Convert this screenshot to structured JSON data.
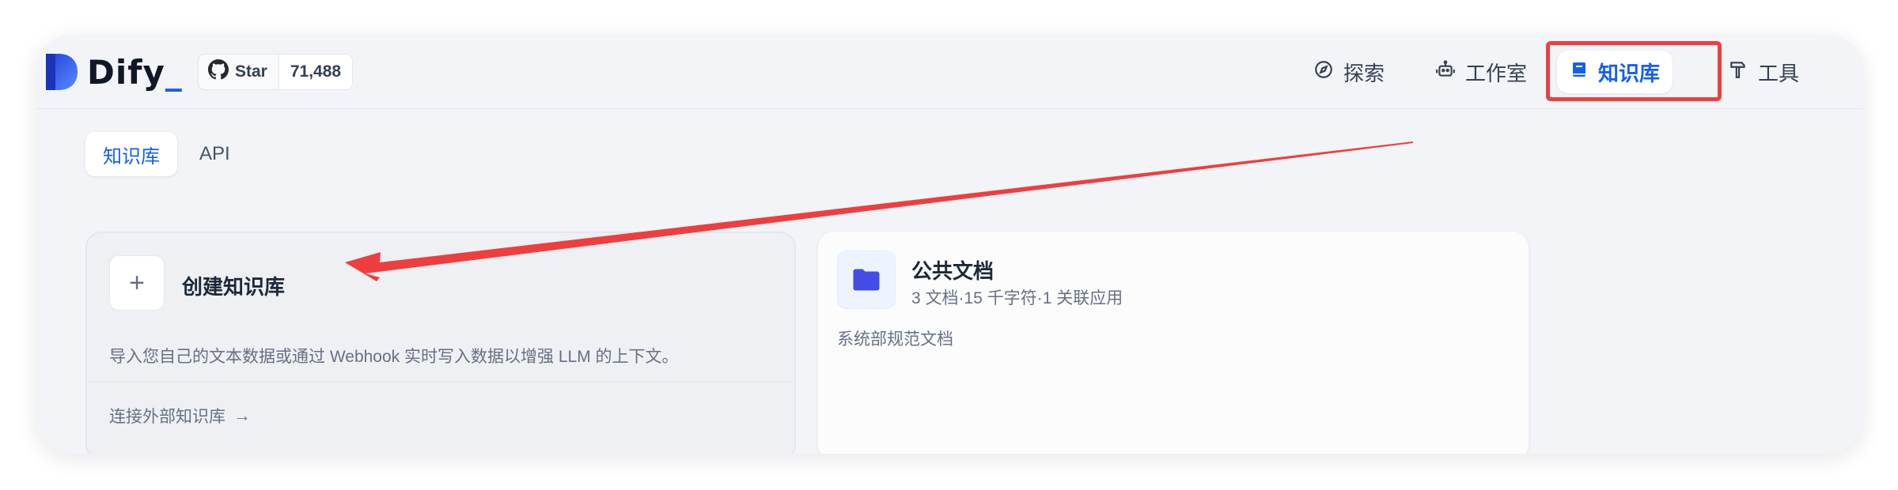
{
  "brand": {
    "name": "Dify",
    "underscore": "_",
    "accent": "#155eef"
  },
  "github": {
    "star_label": "Star",
    "star_count": "71,488",
    "icon": "github-icon"
  },
  "nav": {
    "items": [
      {
        "label": "探索",
        "icon": "compass-icon"
      },
      {
        "label": "工作室",
        "icon": "robot-icon"
      },
      {
        "label": "知识库",
        "icon": "book-icon",
        "active": true
      },
      {
        "label": "工具",
        "icon": "hammer-icon"
      }
    ]
  },
  "tabs": [
    {
      "label": "知识库",
      "active": true
    },
    {
      "label": "API",
      "active": false
    }
  ],
  "create_card": {
    "plus": "+",
    "title": "创建知识库",
    "description": "导入您自己的文本数据或通过 Webhook 实时写入数据以增强 LLM 的上下文。",
    "external_link": "连接外部知识库",
    "external_arrow": "→"
  },
  "datasets": [
    {
      "name": "公共文档",
      "meta": "3 文档·15 千字符·1 关联应用",
      "description": "系统部规范文档",
      "icon": "folder-icon"
    }
  ],
  "annotation": {
    "color": "#ef3e3e"
  }
}
